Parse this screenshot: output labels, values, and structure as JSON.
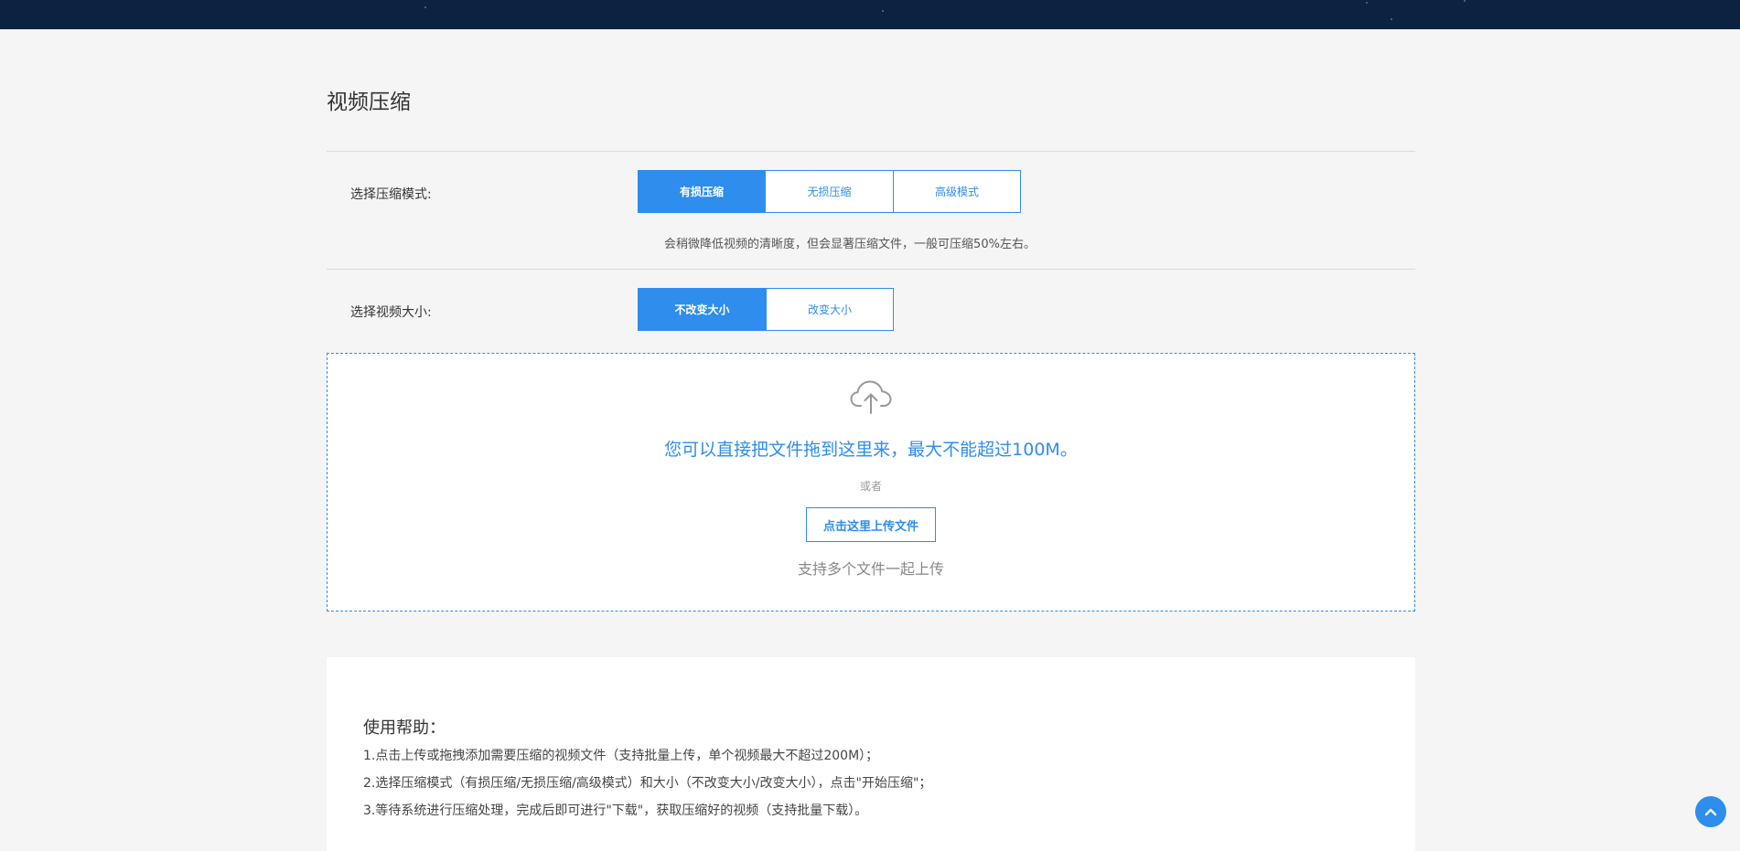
{
  "header": {
    "title": "视频压缩"
  },
  "compression": {
    "label": "选择压缩模式:",
    "options": [
      "有损压缩",
      "无损压缩",
      "高级模式"
    ],
    "selected": "有损压缩",
    "description": "会稍微降低视频的清晰度，但会显著压缩文件，一般可压缩50%左右。"
  },
  "size": {
    "label": "选择视频大小:",
    "options": [
      "不改变大小",
      "改变大小"
    ],
    "selected": "不改变大小"
  },
  "dropzone": {
    "icon": "cloud-upload-icon",
    "main_text": "您可以直接把文件拖到这里来，最大不能超过100M。",
    "or_text": "或者",
    "upload_button": "点击这里上传文件",
    "multi_text": "支持多个文件一起上传"
  },
  "help": {
    "title": "使用帮助：",
    "items": [
      "1.点击上传或拖拽添加需要压缩的视频文件（支持批量上传，单个视频最大不超过200M）；",
      "2.选择压缩模式（有损压缩/无损压缩/高级模式）和大小（不改变大小/改变大小），点击\"开始压缩\"；",
      "3.等待系统进行压缩处理，完成后即可进行\"下载\"，获取压缩好的视频（支持批量下载）。"
    ]
  },
  "colors": {
    "accent": "#2e8ded",
    "topbar": "#0b2240",
    "background": "#f5f5f5"
  },
  "back_to_top_icon": "chevron-up-icon"
}
